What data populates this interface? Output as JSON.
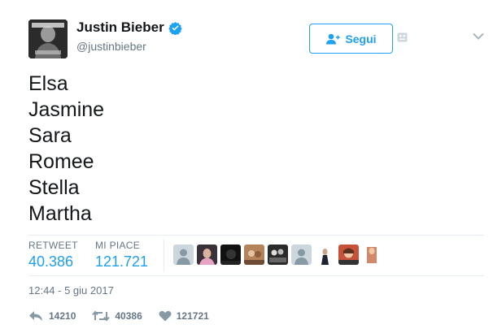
{
  "author": {
    "display_name": "Justin Bieber",
    "handle": "@justinbieber",
    "verified": true
  },
  "follow_button": {
    "label": "Segui",
    "icon": "follow-person-icon"
  },
  "tweet": {
    "lines": [
      "Elsa",
      "Jasmine",
      "Sara",
      "Romee",
      "Stella",
      "Martha"
    ]
  },
  "stats": {
    "retweets": {
      "label": "RETWEET",
      "value": "40.386"
    },
    "likes": {
      "label": "MI PIACE",
      "value": "121.721"
    }
  },
  "timestamp": "12:44 - 5 giu 2017",
  "actions": {
    "reply_count": "14210",
    "retweet_count": "40386",
    "like_count": "121721"
  },
  "colors": {
    "accent": "#1da1f2",
    "muted": "#657786",
    "text": "#14171a",
    "divider": "#e6ecf0"
  }
}
